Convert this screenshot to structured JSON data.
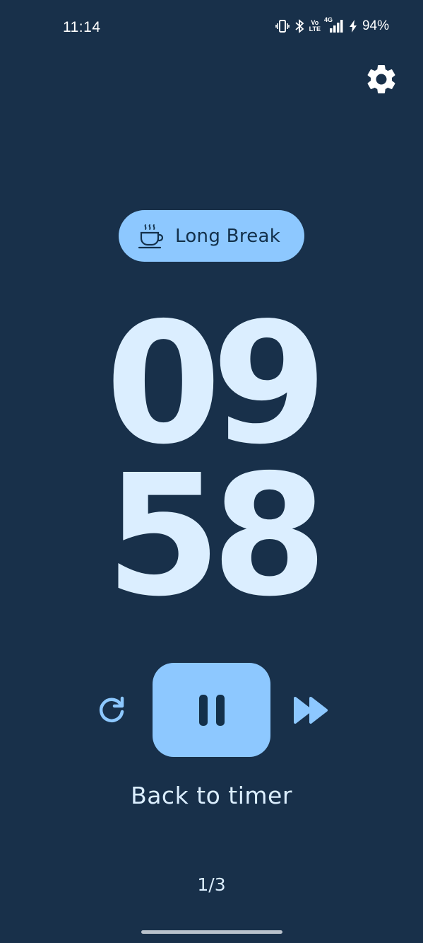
{
  "status_bar": {
    "time": "11:14",
    "network": "4G",
    "volte_top": "Vo",
    "volte_bottom": "LTE",
    "battery": "94%"
  },
  "mode": {
    "label": "Long Break",
    "icon": "coffee-cup-icon"
  },
  "timer": {
    "minutes": "09",
    "seconds": "58"
  },
  "controls": {
    "reset_icon": "refresh-icon",
    "pause_icon": "pause-icon",
    "skip_icon": "fast-forward-icon"
  },
  "back_link": "Back to timer",
  "pager": "1/3",
  "colors": {
    "background": "#18304a",
    "accent": "#8dc8ff",
    "digits": "#dbeeff"
  }
}
